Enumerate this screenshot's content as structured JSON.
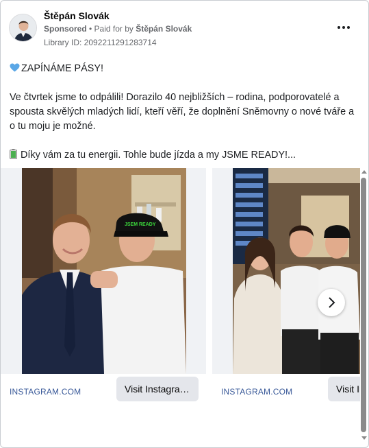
{
  "ad": {
    "page_name": "Štěpán Slovák",
    "sponsored_label": "Sponsored",
    "paid_for_prefix": " • Paid for by ",
    "payer_name": "Štěpán Slovák",
    "library_id": "Library ID: 2092211291283714",
    "more_icon": "more-horizontal-icon"
  },
  "body": {
    "line1": "ZAPÍNÁME PÁSY!",
    "line1_icon": "blue-heart-icon",
    "paragraph2": "Ve čtvrtek jsme to odpálili! Dorazilo 40 nejbližších – rodina, podporovatelé a spousta skvělých mladých lidí, kteří věří, že doplnění Sněmovny o nové tváře a o tu moju je možné.",
    "line3": "Díky vám za tu energii. Tohle bude jízda a my JSME READY!...",
    "line3_icon": "battery-icon"
  },
  "carousel": {
    "cards": [
      {
        "source": "INSTAGRAM.COM",
        "cta": "Visit Instagram profile"
      },
      {
        "source": "INSTAGRAM.COM",
        "cta": "Visit Instagram profile"
      }
    ],
    "next_icon": "chevron-right-icon"
  },
  "colors": {
    "link_blue": "#385898",
    "button_gray": "#e4e6eb",
    "meta_gray": "#65676b"
  }
}
